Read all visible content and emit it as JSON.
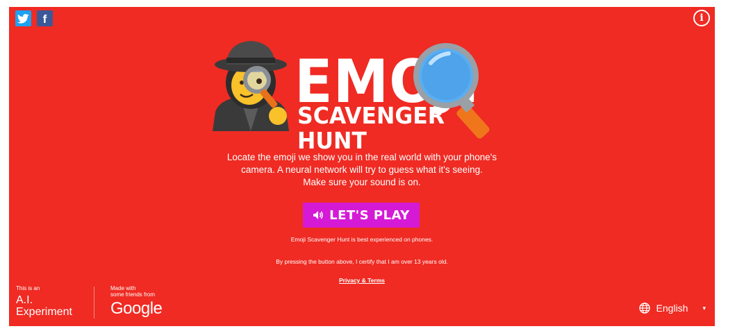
{
  "social": {
    "twitter_icon": "twitter-bird",
    "facebook_letter": "f"
  },
  "info_glyph": "i",
  "logo": {
    "title": "EMOJI",
    "subtitle": "SCAVENGER HUNT"
  },
  "description": [
    "Locate the emoji we show you in the real world with your phone's",
    "camera. A neural network will try to guess what it's seeing.",
    "Make sure your sound is on."
  ],
  "play_button": {
    "label": "LET'S PLAY",
    "icon": "speaker-icon"
  },
  "notes": {
    "best_on_phones": "Emoji Scavenger Hunt is best experienced on phones.",
    "age_certify": "By pressing the button above, I certify that I am over 13 years old.",
    "privacy_link": "Privacy & Terms"
  },
  "footer": {
    "ai_small": "This is an",
    "ai_line1": "A.I.",
    "ai_line2": "Experiment",
    "made_with_1": "Made with",
    "made_with_2": "some friends from",
    "google": "Google",
    "language": "English",
    "language_caret": "▾"
  },
  "colors": {
    "background": "#ef2b23",
    "play_button": "#d51ad6",
    "twitter": "#1da1f2",
    "facebook": "#3b5998"
  }
}
